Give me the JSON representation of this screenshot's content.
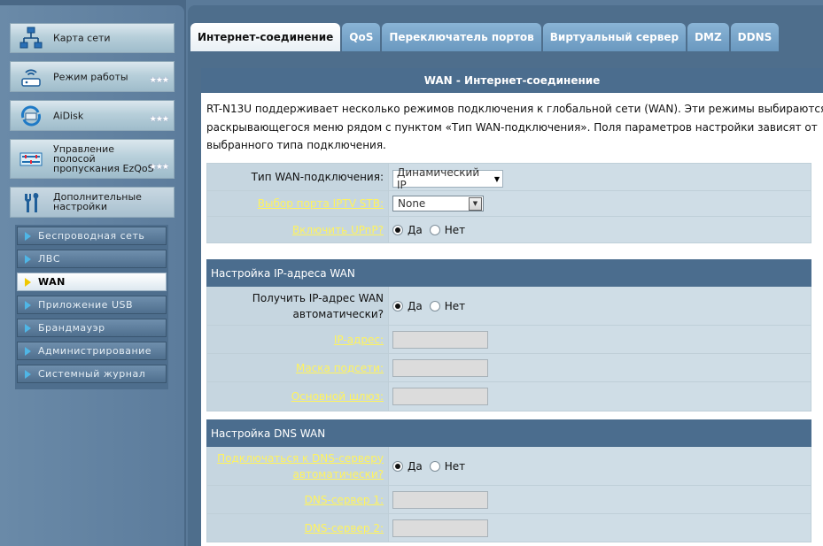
{
  "sidebar": {
    "main_menu": [
      {
        "label": "Карта сети",
        "icon": "network-map-icon"
      },
      {
        "label": "Режим работы",
        "icon": "router-mode-icon"
      },
      {
        "label": "AiDisk",
        "icon": "aidisk-icon"
      },
      {
        "label": "Управление\nполосой\nпропускания EzQoS",
        "icon": "ezqos-icon"
      },
      {
        "label": "Дополнительные\nнастройки",
        "icon": "tools-icon"
      }
    ],
    "stars": "★★★",
    "sub_menu": [
      {
        "label": "Беспроводная сеть",
        "active": false
      },
      {
        "label": "ЛВС",
        "active": false
      },
      {
        "label": "WAN",
        "active": true
      },
      {
        "label": "Приложение USB",
        "active": false
      },
      {
        "label": "Брандмауэр",
        "active": false
      },
      {
        "label": "Администрирование",
        "active": false
      },
      {
        "label": "Системный журнал",
        "active": false
      }
    ]
  },
  "tabs": [
    {
      "label": "Интернет-соединение",
      "active": true
    },
    {
      "label": "QoS",
      "active": false
    },
    {
      "label": "Переключатель портов",
      "active": false
    },
    {
      "label": "Виртуальный сервер",
      "active": false
    },
    {
      "label": "DMZ",
      "active": false
    },
    {
      "label": "DDNS",
      "active": false
    }
  ],
  "panel": {
    "title": "WAN - Интернет-соединение",
    "description_lines": [
      "RT-N13U поддерживает несколько режимов подключения к глобальной сети (WAN). Эти режимы выбираются из",
      "раскрывающегося меню рядом с пунктом «Тип WAN-подключения». Поля параметров настройки зависят от",
      "выбранного типа подключения."
    ]
  },
  "basic": {
    "wan_type_label": "Тип WAN-подключения:",
    "wan_type_value": "Динамический IP",
    "iptv_label": "Выбор порта IPTV STB:",
    "iptv_value": "None",
    "upnp_label": "Включить UPnP?",
    "upnp_value": "yes"
  },
  "ip_section": {
    "title": "Настройка IP-адреса WAN",
    "auto_label_1": "Получить IP-адрес WAN",
    "auto_label_2": "автоматически?",
    "auto_value": "yes",
    "ip_label": "IP-адрес:",
    "mask_label": "Маска подсети:",
    "gateway_label": "Основной шлюз:"
  },
  "dns_section": {
    "title": "Настройка DNS WAN",
    "auto_label_1": "Подключаться к DNS-серверу",
    "auto_label_2": "автоматически?",
    "auto_value": "yes",
    "dns1_label": "DNS-сервер 1:",
    "dns2_label": "DNS-сервер 2:"
  },
  "radio": {
    "yes": "Да",
    "no": "Нет"
  },
  "colors": {
    "accent_link": "#fff35e",
    "header_bar": "#4b6d8e",
    "tab_inactive": "#7aa6cb",
    "active_arrow": "#f0c800"
  }
}
